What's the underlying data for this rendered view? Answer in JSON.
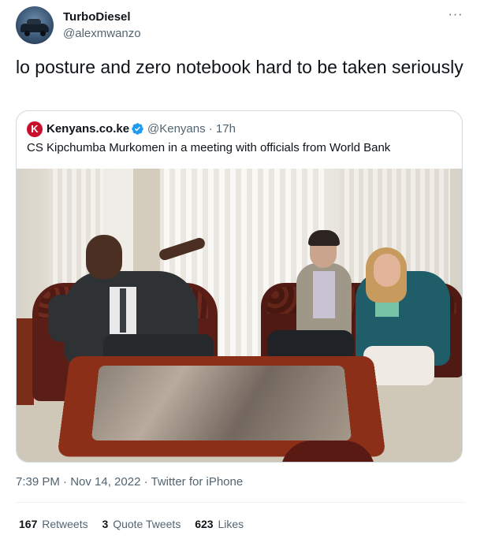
{
  "author": {
    "name": "TurboDiesel",
    "handle": "@alexmwanzo"
  },
  "more_label": "···",
  "tweet_text": "lo posture and zero notebook hard to be taken seriously",
  "quoted": {
    "logo_letter": "K",
    "name": "Kenyans.co.ke",
    "handle_time": "@Kenyans · 17h",
    "text": "CS Kipchumba Murkomen in a meeting with officials from World Bank"
  },
  "meta": "7:39 PM · Nov 14, 2022 · Twitter for iPhone",
  "stats": {
    "retweets_count": "167",
    "retweets_label": "Retweets",
    "quotes_count": "3",
    "quotes_label": "Quote Tweets",
    "likes_count": "623",
    "likes_label": "Likes"
  },
  "colors": {
    "text_primary": "#0f1419",
    "text_secondary": "#536471",
    "verified": "#1d9bf0",
    "border": "#cfd9de",
    "kenyans_red": "#c8102e"
  }
}
